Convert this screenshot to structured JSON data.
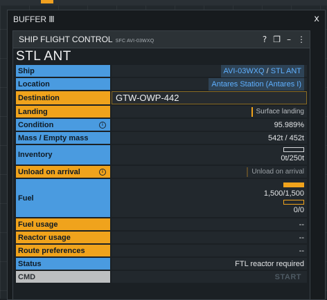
{
  "outer": {
    "title": "BUFFER Ⅲ",
    "close_label": "x"
  },
  "panel": {
    "title": "SHIP FLIGHT CONTROL",
    "subtitle": "SFC AVI-03WXQ",
    "icons": [
      "help-icon",
      "popout-icon",
      "minimize-icon",
      "more-icon"
    ],
    "help_glyph": "?",
    "popout_glyph": "❐",
    "minimize_glyph": "–",
    "more_glyph": "⋮"
  },
  "ship_name": "STL ANT",
  "rows": {
    "ship": {
      "label": "Ship",
      "code": "AVI-03WXQ",
      "sep": " / ",
      "name": "STL ANT"
    },
    "location": {
      "label": "Location",
      "value": "Antares Station (Antares I)"
    },
    "destination": {
      "label": "Destination",
      "value": "GTW-OWP-442"
    },
    "landing": {
      "label": "Landing",
      "value": "Surface landing",
      "active": true
    },
    "condition": {
      "label": "Condition",
      "value": "95.989%",
      "info": "i"
    },
    "mass": {
      "label": "Mass / Empty mass",
      "value": "542t / 452t"
    },
    "inventory": {
      "label": "Inventory",
      "value": "0t/250t",
      "fill_fraction": 0.0
    },
    "unload": {
      "label": "Unload on arrival",
      "value": "Unload on arrival",
      "info": "i",
      "active": false
    },
    "fuel": {
      "label": "Fuel",
      "stl_value": "1,500/1,500",
      "ftl_value": "0/0",
      "stl_fill_fraction": 1.0,
      "ftl_fill_fraction": 0.0
    },
    "fuel_usage": {
      "label": "Fuel usage",
      "value": "--"
    },
    "reactor_usage": {
      "label": "Reactor usage",
      "value": "--"
    },
    "route_prefs": {
      "label": "Route preferences",
      "value": "--"
    },
    "status": {
      "label": "Status",
      "value": "FTL reactor required"
    },
    "cmd": {
      "label": "CMD",
      "button": "START"
    }
  },
  "colors": {
    "accent_orange": "#f0a31c",
    "label_blue": "#4a9be0",
    "link_blue": "#5fb0ff",
    "disabled": "#4e5a63"
  }
}
